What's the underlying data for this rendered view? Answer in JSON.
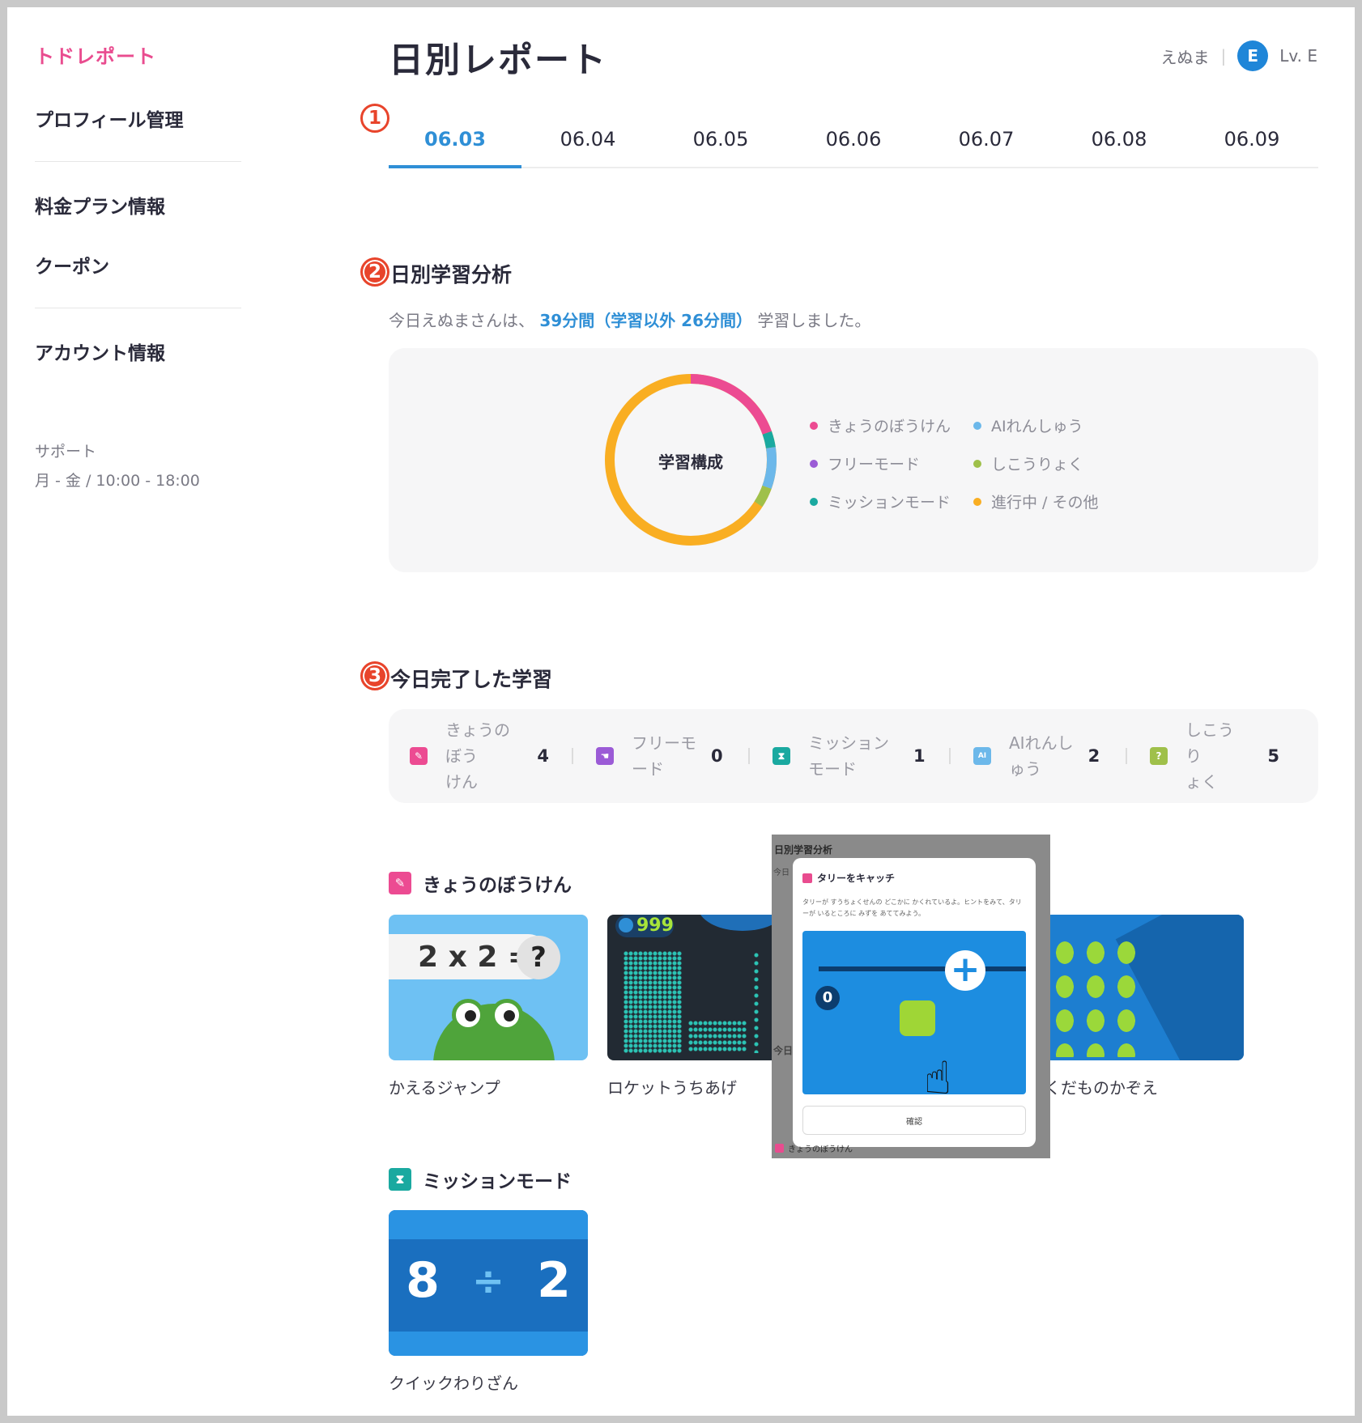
{
  "sidebar": {
    "brand": "トドレポート",
    "items": [
      {
        "label": "プロフィール管理"
      },
      {
        "label": "料金プラン情報"
      },
      {
        "label": "クーポン"
      },
      {
        "label": "アカウント情報"
      }
    ],
    "support_label": "サポート",
    "support_hours": "月 - 金 / 10:00 - 18:00"
  },
  "header": {
    "title": "日別レポート",
    "user_name": "えぬま",
    "avatar_letter": "E",
    "level": "Lv. E"
  },
  "markers": {
    "m1": "1",
    "m2": "2",
    "m3": "3"
  },
  "tabs": [
    "06.03",
    "06.04",
    "06.05",
    "06.06",
    "06.07",
    "06.08",
    "06.09"
  ],
  "active_tab": "06.03",
  "analysis": {
    "title": "日別学習分析",
    "summary_prefix": "今日えぬまさんは、",
    "summary_highlight": "39分間（学習以外 26分間）",
    "summary_suffix": "学習しました。",
    "donut_label": "学習構成",
    "legend": [
      {
        "label": "きょうのぼうけん",
        "color": "#ec4b92"
      },
      {
        "label": "AIれんしゅう",
        "color": "#6cb8ea"
      },
      {
        "label": "フリーモード",
        "color": "#9b5bd6"
      },
      {
        "label": "しこうりょく",
        "color": "#9fc04a"
      },
      {
        "label": "ミッションモード",
        "color": "#1aa9a0"
      },
      {
        "label": "進行中 / その他",
        "color": "#f9ae22"
      }
    ]
  },
  "completed": {
    "title": "今日完了した学習",
    "stats": [
      {
        "label_l1": "きょうのぼう",
        "label_l2": "けん",
        "value": "4",
        "icon": "pencil-icon",
        "color": "#ec4b92"
      },
      {
        "label_l1": "フリーモ",
        "label_l2": "ード",
        "value": "0",
        "icon": "hand-icon",
        "color": "#9b5bd6"
      },
      {
        "label_l1": "ミッション",
        "label_l2": "モード",
        "value": "1",
        "icon": "hourglass-icon",
        "color": "#1aa9a0"
      },
      {
        "label_l1": "AIれんし",
        "label_l2": "ゅう",
        "value": "2",
        "icon": "ai-icon",
        "color": "#6cb8ea"
      },
      {
        "label_l1": "しこうり",
        "label_l2": "ょく",
        "value": "5",
        "icon": "question-icon",
        "color": "#9fc04a"
      }
    ],
    "stat_icon_glyphs": {
      "ai": "AI",
      "question": "?"
    }
  },
  "adventure": {
    "title": "きょうのぼうけん",
    "games": [
      {
        "name": "かえるジャンプ",
        "equation": "2 x 2 =",
        "q": "?"
      },
      {
        "name": "ロケットうちあげ",
        "score": "999"
      },
      {
        "name": "くだものかぞえ"
      }
    ]
  },
  "mission": {
    "title": "ミッションモード",
    "games": [
      {
        "name": "クイックわりざん",
        "a": "8",
        "op": "÷",
        "b": "2"
      }
    ]
  },
  "overlay": {
    "top_title": "日別学習分析",
    "side_a": "今日",
    "side_b": "今日",
    "modal_title": "タリーをキャッチ",
    "modal_desc": "タリーが すうちょくせんの どこかに かくれているよ。ヒントをみて、タリーが いるところに みずを あててみよう。",
    "zero": "0",
    "confirm": "確認",
    "bottom": "きょうのぼうけん"
  }
}
